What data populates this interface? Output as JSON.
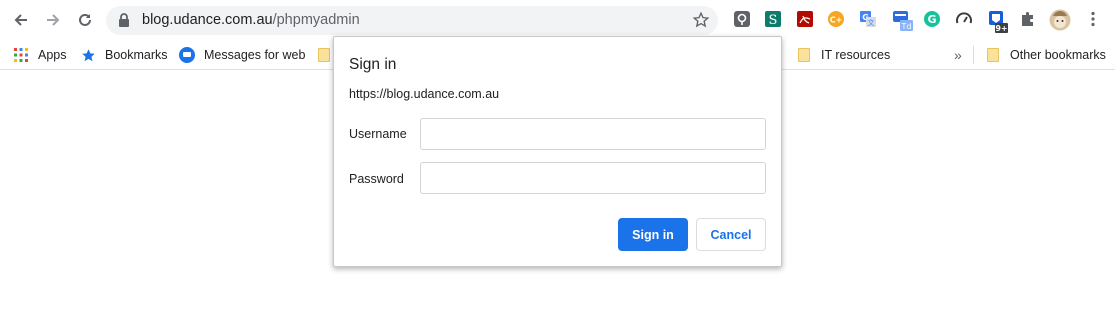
{
  "browser": {
    "url_host": "blog.udance.com.au",
    "url_path": "/phpmyadmin",
    "icons": [
      "back-icon",
      "forward-icon",
      "reload-icon",
      "lock-icon",
      "star-icon",
      "extensions-icon",
      "menu-icon"
    ],
    "extensions": [
      {
        "name": "pocket-ext-icon",
        "color": "#5f6368"
      },
      {
        "name": "s-ext-icon",
        "color": "#0f7b6c"
      },
      {
        "name": "pdf-ext-icon",
        "color": "#b30b00"
      },
      {
        "name": "coupon-ext-icon",
        "color": "#f5a623"
      },
      {
        "name": "translate-ext-icon",
        "color": "#4285f4"
      },
      {
        "name": "todoist-ext-icon",
        "color": "#2d6cdf"
      },
      {
        "name": "grammarly-ext-icon",
        "color": "#15c39a"
      },
      {
        "name": "speedometer-ext-icon",
        "color": "#3c4043"
      },
      {
        "name": "bitwarden-ext-icon",
        "color": "#175ddc"
      }
    ],
    "ext_badges": {
      "todoist": "Td",
      "bitwarden": "9+"
    }
  },
  "bookmarks": {
    "items": [
      {
        "label": "Apps",
        "icon": "apps-grid-icon"
      },
      {
        "label": "Bookmarks",
        "icon": "star-icon"
      },
      {
        "label": "Messages for web",
        "icon": "messages-icon"
      },
      {
        "label": "IT resources",
        "icon": "folder-icon"
      }
    ],
    "overflow": "»",
    "other": "Other bookmarks"
  },
  "dialog": {
    "title": "Sign in",
    "origin": "https://blog.udance.com.au",
    "username_label": "Username",
    "password_label": "Password",
    "username_value": "",
    "password_value": "",
    "signin_button": "Sign in",
    "cancel_button": "Cancel"
  },
  "colors": {
    "accent": "#1a73e8",
    "omnibox_bg": "#f1f3f4"
  }
}
